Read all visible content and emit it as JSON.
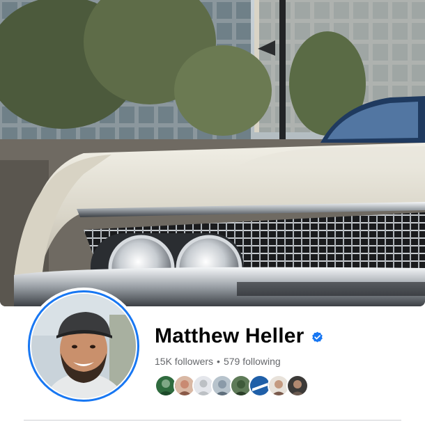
{
  "profile": {
    "name": "Matthew Heller",
    "verified_icon": "verified-badge-icon",
    "followers": "15K followers",
    "separator": "•",
    "following": "579 following",
    "accent_color": "#1877f2"
  },
  "cover_photo": {
    "subject": "cover-photo"
  },
  "friends": [
    {
      "avatar_color": "#2f6b3e"
    },
    {
      "avatar_color": "#c98a72"
    },
    {
      "avatar_color": "#bcc0c4"
    },
    {
      "avatar_color": "#8a9aa8"
    },
    {
      "avatar_color": "#3e5a3a"
    },
    {
      "avatar_color": "#1f5fa8"
    },
    {
      "avatar_color": "#7a5a4c"
    },
    {
      "avatar_color": "#6b5a50"
    }
  ]
}
